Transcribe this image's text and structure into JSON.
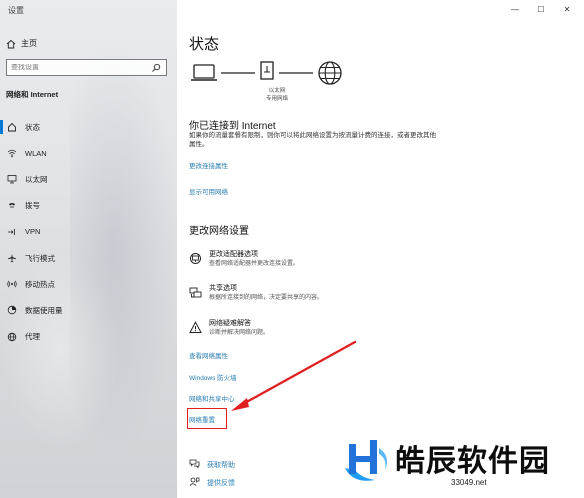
{
  "window": {
    "title": "设置",
    "controls": [
      "—",
      "☐",
      "✕"
    ]
  },
  "sidebar": {
    "home_label": "主页",
    "search_placeholder": "查找设置",
    "section_title": "网络和 Internet",
    "items": [
      {
        "label": "状态",
        "icon": "home-status-icon",
        "active": true
      },
      {
        "label": "WLAN",
        "icon": "wifi-icon"
      },
      {
        "label": "以太网",
        "icon": "ethernet-icon"
      },
      {
        "label": "拨号",
        "icon": "dialup-icon"
      },
      {
        "label": "VPN",
        "icon": "vpn-icon"
      },
      {
        "label": "飞行模式",
        "icon": "airplane-icon"
      },
      {
        "label": "移动热点",
        "icon": "hotspot-icon"
      },
      {
        "label": "数据使用量",
        "icon": "data-usage-icon"
      },
      {
        "label": "代理",
        "icon": "globe-icon"
      }
    ]
  },
  "main": {
    "title": "状态",
    "diagram": {
      "adapter_label": "以太网",
      "network_label": "专用网络"
    },
    "connected_heading": "你已连接到 Internet",
    "connected_desc": "如果你的流量套餐有限制，则你可以将此网络设置为按流量计费的连接，或者更改其他属性。",
    "links_top": [
      "更改连接属性",
      "显示可用网络"
    ],
    "change_heading": "更改网络设置",
    "options": [
      {
        "title": "更改适配器选项",
        "sub": "查看网络适配器并更改连接设置。",
        "icon": "adapter-icon"
      },
      {
        "title": "共享选项",
        "sub": "根据所连接到的网络，决定要共享的内容。",
        "icon": "sharing-icon"
      },
      {
        "title": "网络疑难解答",
        "sub": "诊断并解决网络问题。",
        "icon": "warning-icon"
      }
    ],
    "links_bottom": [
      "查看网络属性",
      "Windows 防火墙",
      "网络和共享中心",
      "网络重置"
    ],
    "help": [
      {
        "label": "获取帮助",
        "icon": "help-chat-icon"
      },
      {
        "label": "提供反馈",
        "icon": "feedback-icon"
      }
    ]
  },
  "watermark": {
    "name": "皓辰软件园",
    "url": "33049.net"
  },
  "colors": {
    "accent": "#0078d7",
    "link": "#2a7fb4",
    "highlight": "#e02020"
  }
}
